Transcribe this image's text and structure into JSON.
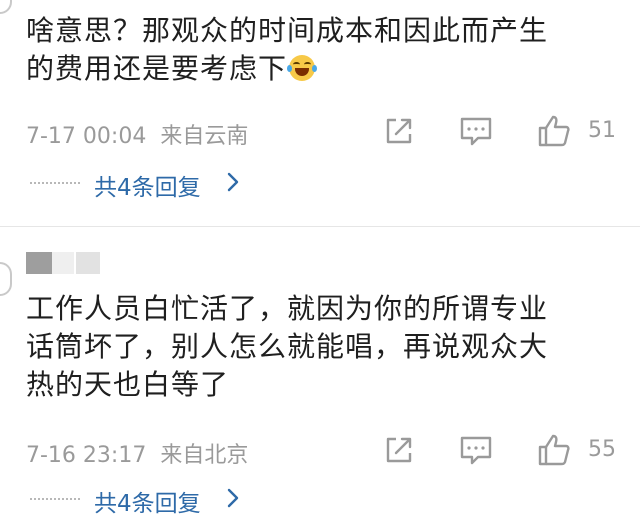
{
  "comments": [
    {
      "line1": "啥意思？那观众的时间成本和因此而产生",
      "line2": "的费用还是要考虑下",
      "emoji": "laughing-tears-emoji",
      "time": "7-17 00:04",
      "source": "来自云南",
      "likes": "51",
      "replies_label": "共4条回复"
    },
    {
      "line1": "工作人员白忙活了，就因为你的所谓专业",
      "line2": "话筒坏了，别人怎么就能唱，再说观众大",
      "line3": "热的天也白等了",
      "time": "7-16 23:17",
      "source": "来自北京",
      "likes": "55",
      "replies_label": "共4条回复"
    }
  ],
  "icons": {
    "share": "share-icon",
    "comment": "comment-icon",
    "like": "thumbs-up-icon",
    "chevron": "chevron-right-icon"
  },
  "colors": {
    "meta_text": "#9a9a9a",
    "reply_link": "#2e6aa8",
    "body_text": "#1f1f1f"
  }
}
